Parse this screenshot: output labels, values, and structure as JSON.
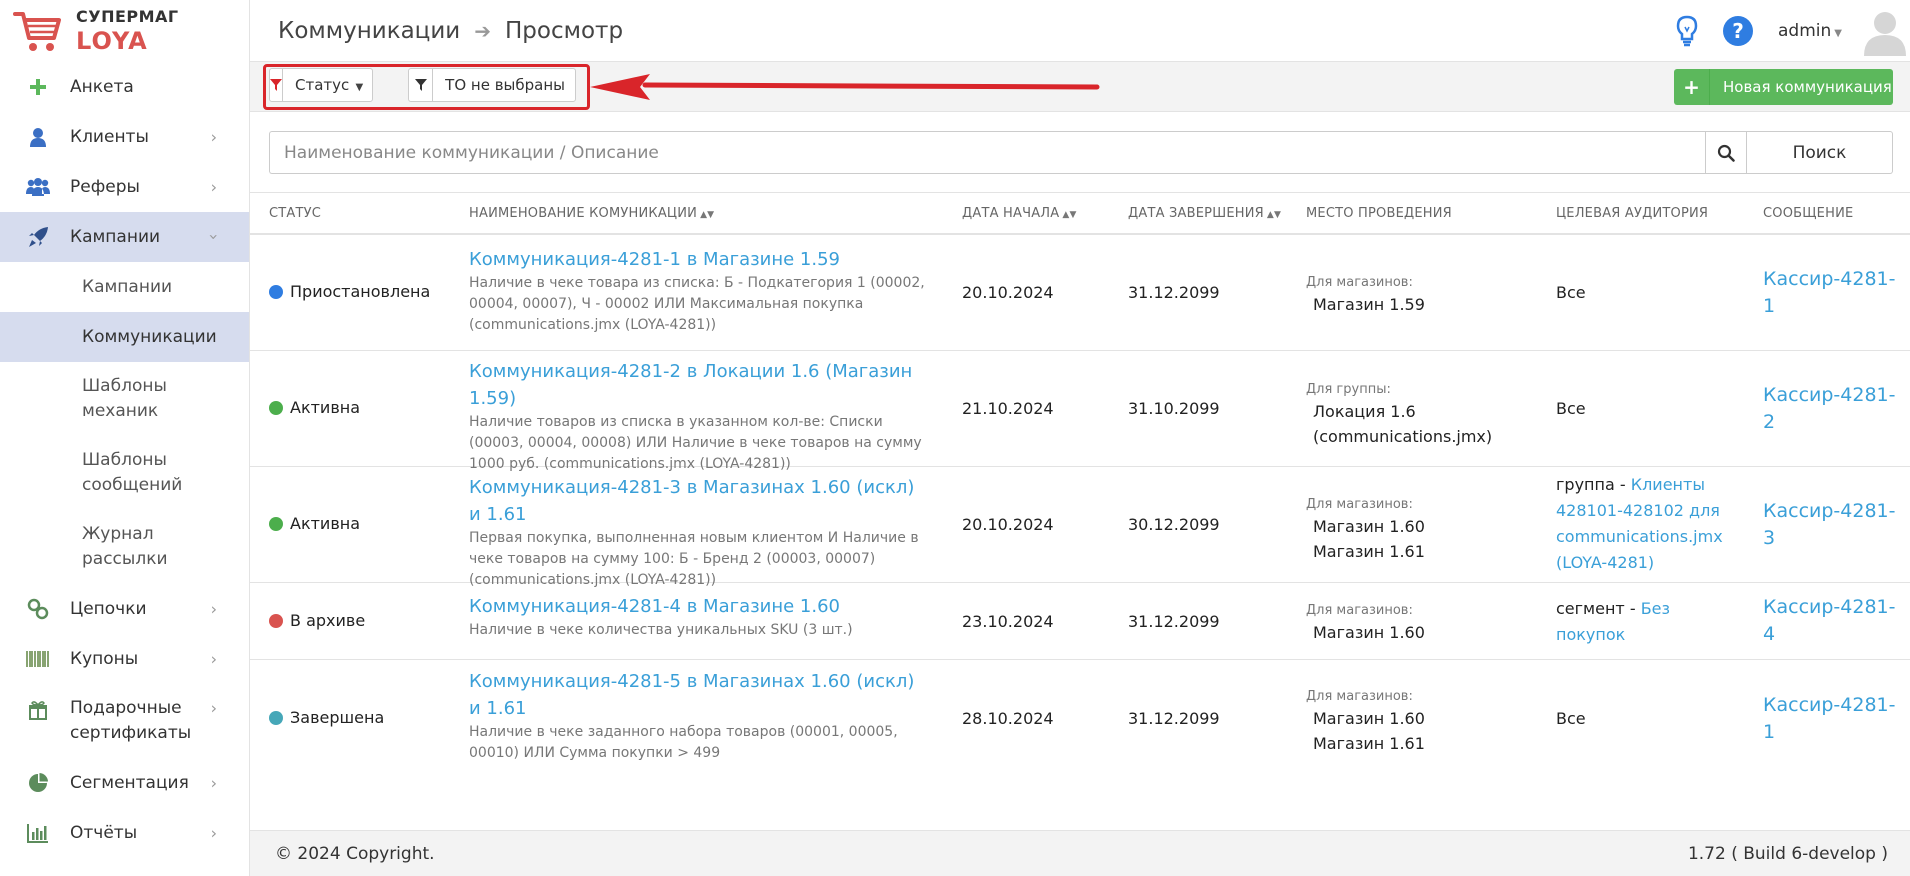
{
  "logo": {
    "line1": "СУПЕРМАГ",
    "line2": "LOYA",
    "brand_color": "#d9534f"
  },
  "sidebar": {
    "items": [
      {
        "label": "Анкета",
        "icon": "plus-icon"
      },
      {
        "label": "Клиенты",
        "icon": "user-icon"
      },
      {
        "label": "Реферы",
        "icon": "users-icon"
      },
      {
        "label": "Кампании",
        "icon": "rocket-icon",
        "active": true
      },
      {
        "label": "Цепочки",
        "icon": "link-icon"
      },
      {
        "label": "Купоны",
        "icon": "barcode-icon"
      },
      {
        "label": "Подарочные сертификаты",
        "icon": "gift-icon"
      },
      {
        "label": "Сегментация",
        "icon": "pie-chart-icon"
      },
      {
        "label": "Отчёты",
        "icon": "bar-chart-icon"
      }
    ],
    "sub": [
      {
        "label": "Кампании"
      },
      {
        "label": "Коммуникации",
        "active": true
      },
      {
        "label": "Шаблоны механик"
      },
      {
        "label": "Шаблоны сообщений"
      },
      {
        "label": "Журнал рассылки"
      }
    ]
  },
  "header": {
    "crumb1": "Коммуникации",
    "crumb2": "Просмотр",
    "user": "admin"
  },
  "toolbar": {
    "filter_status": "Статус",
    "filter_to": "ТО не выбраны",
    "new_button": "Новая коммуникация",
    "accent_color": "#5cb85c",
    "highlight_color": "#d9252a"
  },
  "search": {
    "placeholder": "Наименование коммуникации / Описание",
    "value": "",
    "button": "Поиск"
  },
  "table": {
    "headers": {
      "status": "СТАТУС",
      "name": "НАИМЕНОВАНИЕ КОМУНИКАЦИИ",
      "start": "ДАТА НАЧАЛА",
      "end": "ДАТА ЗАВЕРШЕНИЯ",
      "place": "МЕСТО ПРОВЕДЕНИЯ",
      "audience": "ЦЕЛЕВАЯ АУДИТОРИЯ",
      "message": "СООБЩЕНИЕ"
    },
    "rows": [
      {
        "status": "Приостановлена",
        "status_color": "#2f7de1",
        "title": "Коммуникация-4281-1 в Магазине 1.59",
        "desc": "Наличие в чеке товара из списка: Б - Подкатегория 1 (00002, 00004, 00007), Ч - 00002 ИЛИ Максимальная покупка (communications.jmx (LOYA-4281))",
        "start": "20.10.2024",
        "end": "31.12.2099",
        "place_label": "Для магазинов:",
        "place": "Магазин 1.59",
        "audience": "Все",
        "message": "Кассир-4281-1"
      },
      {
        "status": "Активна",
        "status_color": "#4cae4c",
        "title": "Коммуникация-4281-2 в Локации 1.6 (Магазин 1.59)",
        "desc": "Наличие товаров из списка в указанном кол-ве: Списки (00003, 00004, 00008) ИЛИ Наличие в чеке товаров на сумму 1000 руб. (communications.jmx (LOYA-4281))",
        "start": "21.10.2024",
        "end": "31.10.2099",
        "place_label": "Для группы:",
        "place": "Локация 1.6 (communications.jmx)",
        "audience": "Все",
        "message": "Кассир-4281-2"
      },
      {
        "status": "Активна",
        "status_color": "#4cae4c",
        "title": "Коммуникация-4281-3 в Магазинах 1.60 (искл) и 1.61",
        "desc": "Первая покупка, выполненная новым клиентом И Наличие в чеке товаров на сумму 100: Б - Бренд 2 (00003, 00007) (communications.jmx (LOYA-4281))",
        "start": "20.10.2024",
        "end": "30.12.2099",
        "place_label": "Для магазинов:",
        "place": "Магазин 1.60",
        "place2": "Магазин 1.61",
        "audience_prefix": "группа - ",
        "audience_link": "Клиенты 428101-428102 для communications.jmx (LOYA-4281)",
        "message": "Кассир-4281-3"
      },
      {
        "status": "В архиве",
        "status_color": "#d9534f",
        "title": "Коммуникация-4281-4 в Магазине 1.60",
        "desc": "Наличие в чеке количества уникальных SKU (3 шт.)",
        "start": "23.10.2024",
        "end": "31.12.2099",
        "place_label": "Для магазинов:",
        "place": "Магазин 1.60",
        "audience_prefix": "сегмент - ",
        "audience_link": "Без покупок",
        "message": "Кассир-4281-4"
      },
      {
        "status": "Завершена",
        "status_color": "#46a7b8",
        "title": "Коммуникация-4281-5 в Магазинах 1.60 (искл) и 1.61",
        "desc": "Наличие в чеке заданного набора товаров (00001, 00005, 00010) ИЛИ Сумма покупки > 499",
        "start": "28.10.2024",
        "end": "31.12.2099",
        "place_label": "Для магазинов:",
        "place": "Магазин 1.60",
        "place2": "Магазин 1.61",
        "audience": "Все",
        "message": "Кассир-4281-1"
      }
    ]
  },
  "footer": {
    "copyright": "© 2024 Copyright.",
    "version": "1.72 ( Build 6-develop )"
  }
}
